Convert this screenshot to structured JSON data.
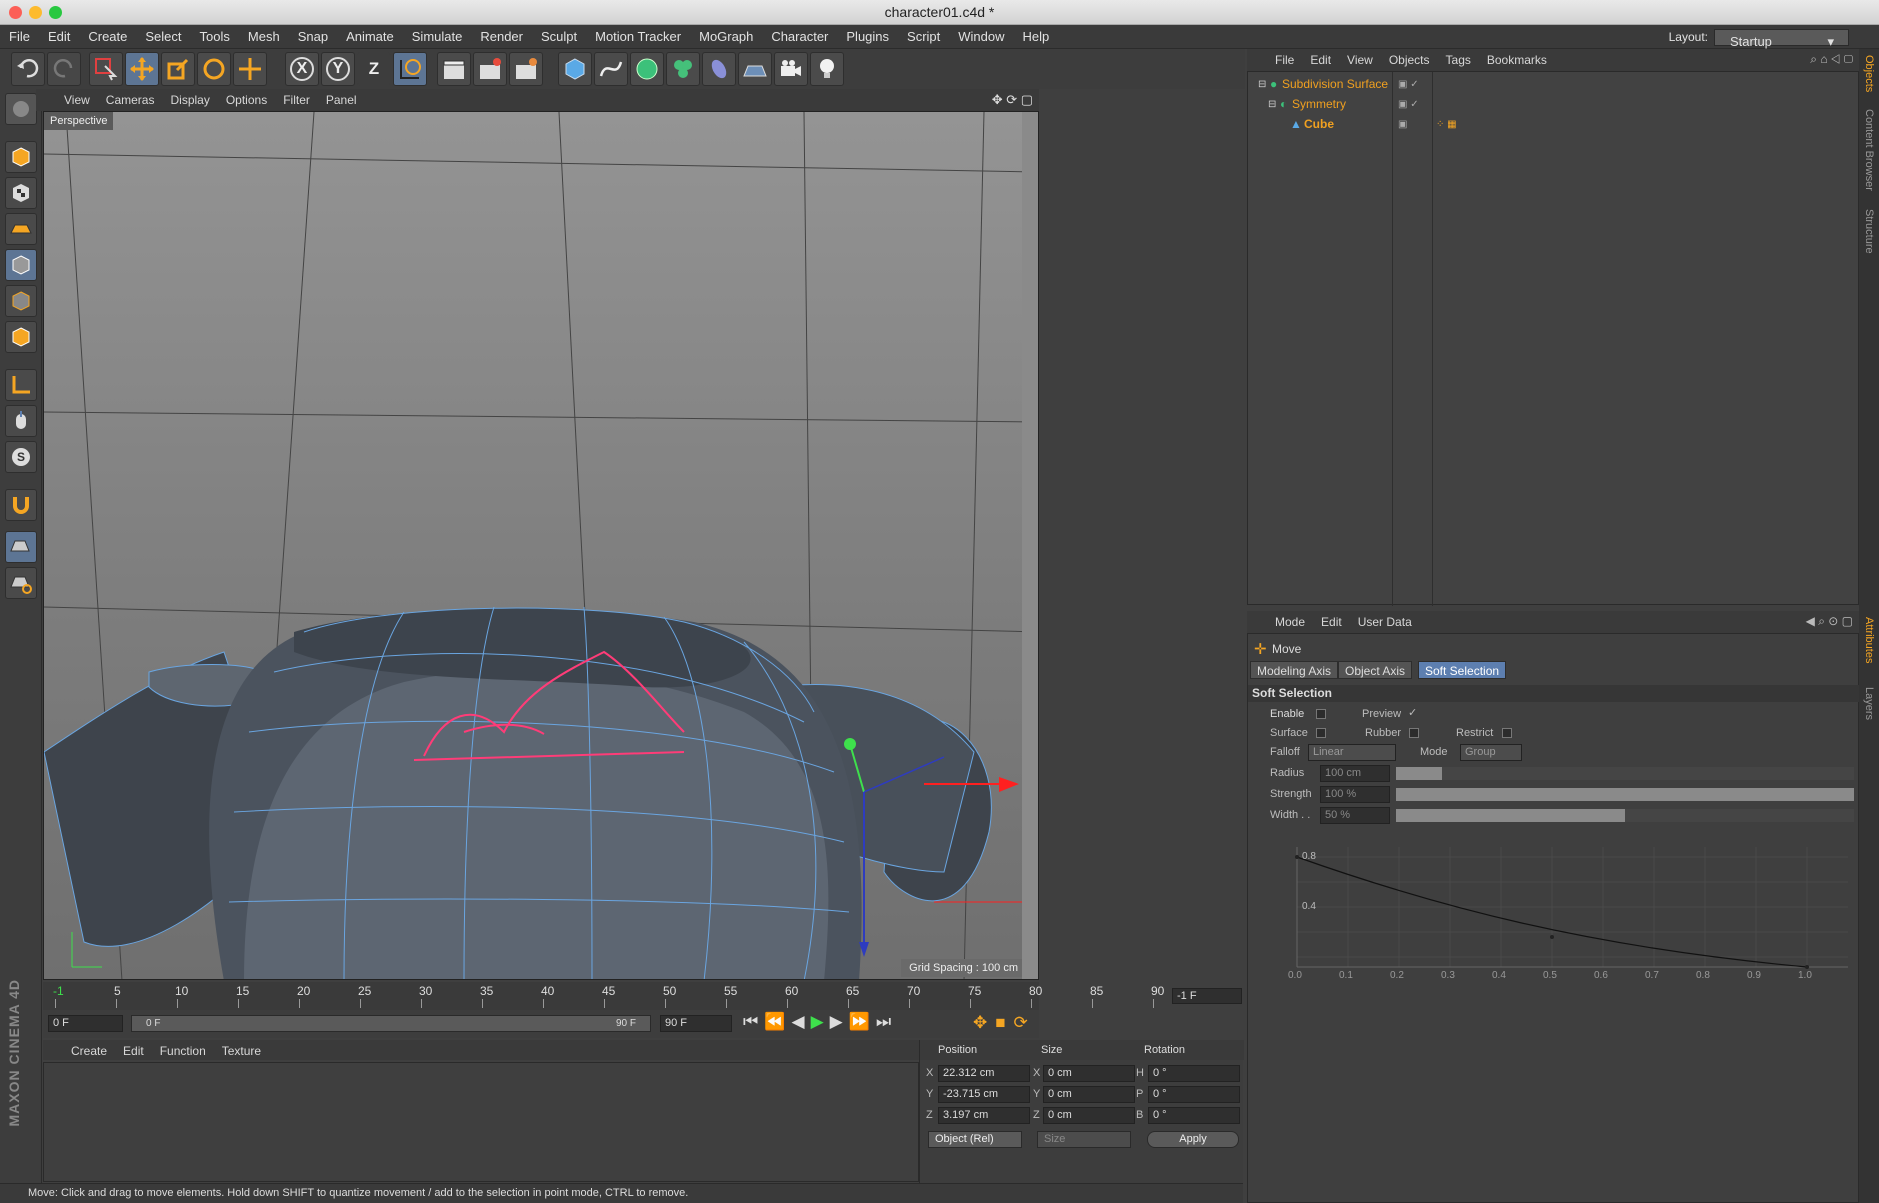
{
  "window": {
    "title": "character01.c4d *"
  },
  "menu": [
    "File",
    "Edit",
    "Create",
    "Select",
    "Tools",
    "Mesh",
    "Snap",
    "Animate",
    "Simulate",
    "Render",
    "Sculpt",
    "Motion Tracker",
    "MoGraph",
    "Character",
    "Plugins",
    "Script",
    "Window",
    "Help"
  ],
  "layout": {
    "label": "Layout:",
    "value": "Startup"
  },
  "toolbar": {
    "axis_x": "X",
    "axis_y": "Y",
    "axis_z": "Z"
  },
  "viewport": {
    "menu": [
      "View",
      "Cameras",
      "Display",
      "Options",
      "Filter",
      "Panel"
    ],
    "camera_label": "Perspective",
    "grid_spacing": "Grid Spacing : 100 cm"
  },
  "object_manager": {
    "menu": [
      "File",
      "Edit",
      "View",
      "Objects",
      "Tags",
      "Bookmarks"
    ],
    "objects": [
      {
        "name": "Subdivision Surface",
        "indent": 0
      },
      {
        "name": "Symmetry",
        "indent": 1
      },
      {
        "name": "Cube",
        "indent": 2
      }
    ]
  },
  "side_tabs": {
    "right_top": [
      "Objects",
      "Content Browser",
      "Structure"
    ],
    "right_bottom": [
      "Attributes",
      "Layers"
    ]
  },
  "attributes": {
    "menu": [
      "Mode",
      "Edit",
      "User Data"
    ],
    "tool_name": "Move",
    "tabs": [
      "Modeling Axis",
      "Object Axis",
      "Soft Selection"
    ],
    "active_tab": "Soft Selection",
    "section_title": "Soft Selection",
    "enable_label": "Enable",
    "preview_label": "Preview",
    "preview_check": "✓",
    "surface_label": "Surface",
    "rubber_label": "Rubber",
    "restrict_label": "Restrict",
    "falloff_label": "Falloff",
    "falloff_value": "Linear",
    "mode_label": "Mode",
    "mode_value": "Group",
    "radius_label": "Radius",
    "radius_value": "100 cm",
    "radius_fill": 0.1,
    "strength_label": "Strength",
    "strength_value": "100 %",
    "strength_fill": 1.0,
    "width_label": "Width . .",
    "width_value": "50 %",
    "width_fill": 0.5,
    "graph_y_ticks": [
      "0.8",
      "0.4"
    ],
    "graph_x_ticks": [
      "0.0",
      "0.1",
      "0.2",
      "0.3",
      "0.4",
      "0.5",
      "0.6",
      "0.7",
      "0.8",
      "0.9",
      "1.0"
    ]
  },
  "timeline": {
    "ticks": [
      "-1",
      "5",
      "10",
      "15",
      "20",
      "25",
      "30",
      "35",
      "40",
      "45",
      "50",
      "55",
      "60",
      "65",
      "70",
      "75",
      "80",
      "85",
      "90"
    ],
    "current_frame_display": "-1 F",
    "start_frame": "0 F",
    "range_start": "0 F",
    "range_end": "90 F",
    "end_frame": "90 F"
  },
  "material_manager": {
    "menu": [
      "Create",
      "Edit",
      "Function",
      "Texture"
    ]
  },
  "coordinates": {
    "headers": [
      "Position",
      "Size",
      "Rotation"
    ],
    "pos_x": "22.312 cm",
    "pos_y": "-23.715 cm",
    "pos_z": "3.197 cm",
    "size_x": "0 cm",
    "size_y": "0 cm",
    "size_z": "0 cm",
    "rot_h": "0 °",
    "rot_p": "0 °",
    "rot_b": "0 °",
    "labels_pos": [
      "X",
      "Y",
      "Z"
    ],
    "labels_size": [
      "X",
      "Y",
      "Z"
    ],
    "labels_rot": [
      "H",
      "P",
      "B"
    ],
    "mode_select": "Object (Rel)",
    "size_select": "Size",
    "apply_label": "Apply"
  },
  "brand": "MAXON CINEMA 4D",
  "status": "Move: Click and drag to move elements. Hold down SHIFT to quantize movement / add to the selection in point mode, CTRL to remove.",
  "colors": {
    "accent": "#5d7fb0",
    "object_name": "#f0a020",
    "bg": "#3f3f3f"
  }
}
